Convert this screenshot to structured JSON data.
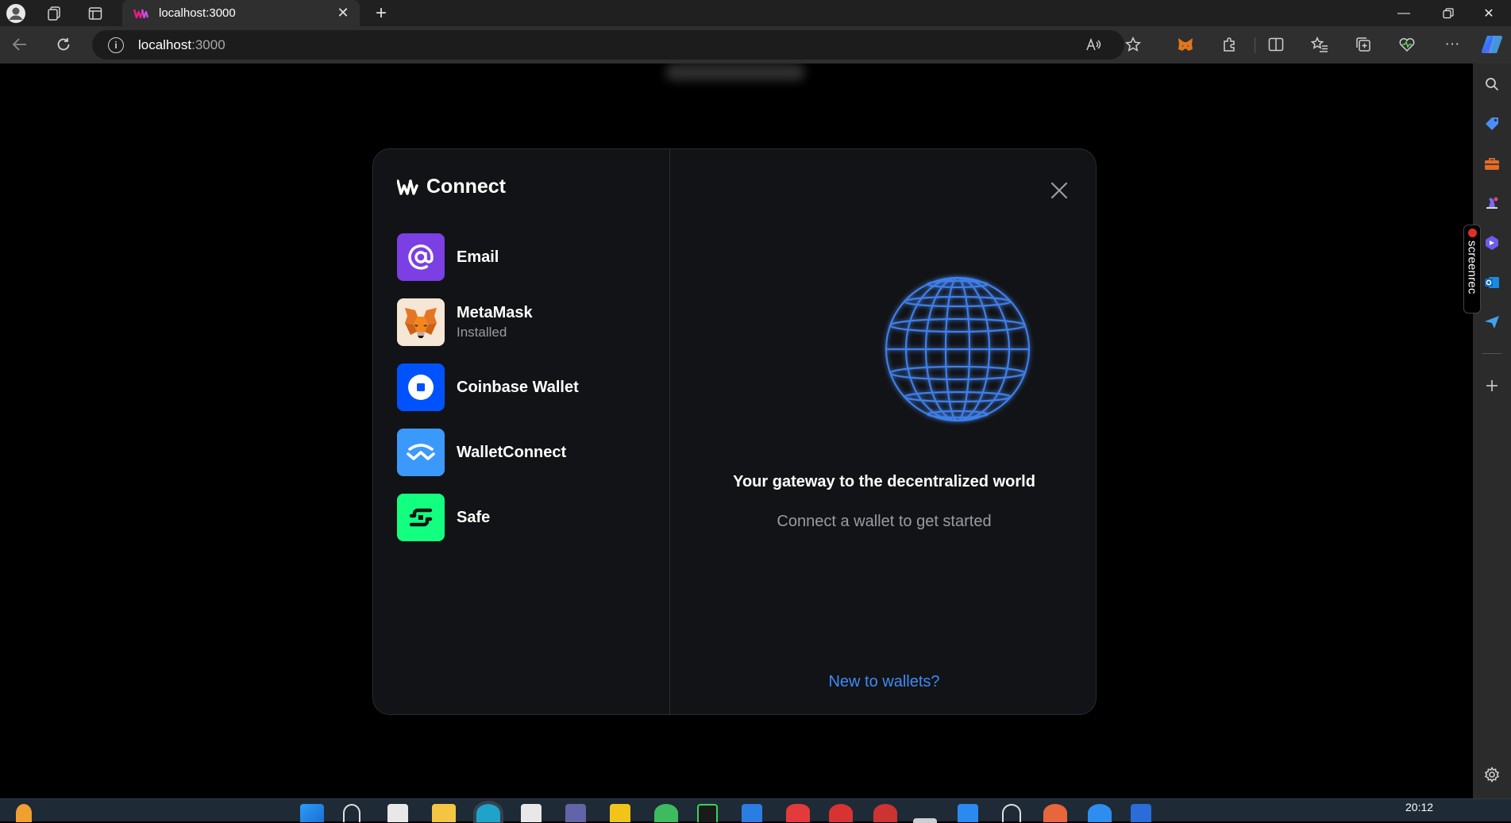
{
  "browser": {
    "tab_title": "localhost:3000",
    "address_host": "localhost",
    "address_port": ":3000"
  },
  "sidebar": {
    "screenrec_label": "screenrec"
  },
  "modal": {
    "title": "Connect",
    "wallets": [
      {
        "name": "Email",
        "sub": ""
      },
      {
        "name": "MetaMask",
        "sub": "Installed"
      },
      {
        "name": "Coinbase Wallet",
        "sub": ""
      },
      {
        "name": "WalletConnect",
        "sub": ""
      },
      {
        "name": "Safe",
        "sub": ""
      }
    ],
    "tagline": "Your gateway to the decentralized world",
    "subline": "Connect a wallet to get started",
    "new_link": "New to wallets?"
  },
  "taskbar": {
    "clock": "20:12"
  },
  "colors": {
    "modal_bg": "#121316",
    "accent_link": "#3d8bf7",
    "email_icon": "#7b3fe4",
    "coinbase_icon": "#0052ff",
    "walletconnect_icon": "#3b99fc",
    "safe_icon": "#12ff80",
    "globe": "#3f7fe8"
  }
}
